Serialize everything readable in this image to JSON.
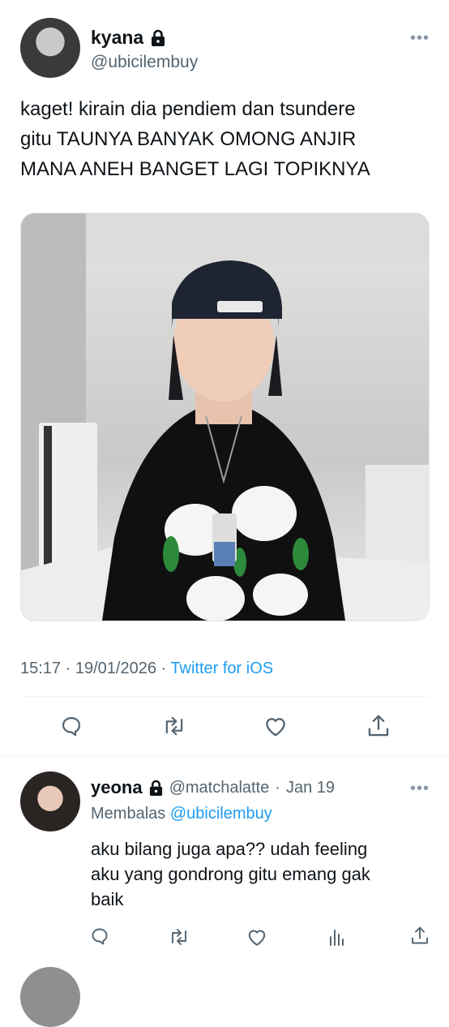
{
  "tweet": {
    "author_name": "kyana",
    "author_handle": "@ubicilembuy",
    "text_lines": [
      "kaget! kirain dia pendiem dan tsundere",
      "gitu TAUNYA BANYAK OMONG ANJIR",
      "MANA ANEH BANGET LAGI TOPIKNYA"
    ],
    "time": "15:17",
    "separator": "·",
    "date": "19/01/2026",
    "source": "Twitter for iOS",
    "more_label": "•••"
  },
  "actions": {
    "reply_icon": "reply-icon",
    "retweet_icon": "retweet-icon",
    "like_icon": "heart-icon",
    "share_icon": "share-icon"
  },
  "reply": {
    "author_name": "yeona",
    "author_handle": "@matchalatte",
    "separator": "·",
    "date": "Jan 19",
    "replying_prefix": "Membalas",
    "replying_to": "@ubicilembuy",
    "text_lines": [
      "aku bilang juga apa?? udah feeling",
      "aku yang gondrong gitu emang gak",
      "baik"
    ],
    "more_label": "•••"
  },
  "colors": {
    "accent": "#1d9bf0",
    "text": "#0f1419",
    "secondary": "#536471",
    "icon": "#536471"
  }
}
